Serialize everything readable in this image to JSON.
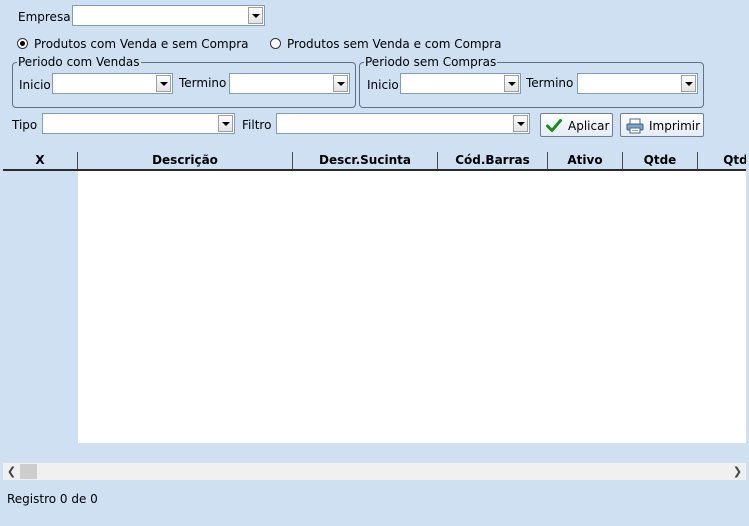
{
  "empresa": {
    "label": "Empresa",
    "value": ""
  },
  "radios": [
    {
      "label": "Produtos com Venda e sem Compra",
      "checked": true
    },
    {
      "label": "Produtos sem Venda e com Compra",
      "checked": false
    }
  ],
  "periodo_vendas": {
    "legend": "Periodo com Vendas",
    "inicio_label": "Inicio",
    "inicio_value": "",
    "termino_label": "Termino",
    "termino_value": ""
  },
  "periodo_compras": {
    "legend": "Periodo sem Compras",
    "inicio_label": "Inicio",
    "inicio_value": "",
    "termino_label": "Termino",
    "termino_value": ""
  },
  "tipo": {
    "label": "Tipo",
    "value": ""
  },
  "filtro": {
    "label": "Filtro",
    "value": ""
  },
  "buttons": {
    "aplicar": "Aplicar",
    "imprimir": "Imprimir"
  },
  "grid": {
    "columns": [
      "X",
      "Descrição",
      "Descr.Sucinta",
      "Cód.Barras",
      "Ativo",
      "Qtde",
      "Qtd"
    ],
    "rows": []
  },
  "status": "Registro 0 de 0",
  "icons": {
    "aplicar": "checkmark-icon",
    "imprimir": "printer-icon"
  },
  "colors": {
    "background": "#cfe0f3",
    "check_green": "#1f8a1f"
  }
}
